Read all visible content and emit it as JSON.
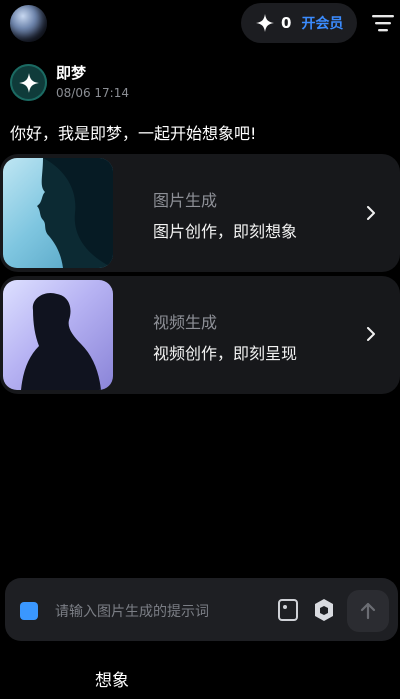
{
  "header": {
    "credits": "0",
    "join_vip": "开会员"
  },
  "message": {
    "bot_name": "即梦",
    "time": "08/06 17:14",
    "greeting": "你好，我是即梦，一起开始想象吧!"
  },
  "cards": [
    {
      "title": "图片生成",
      "subtitle": "图片创作，即刻想象"
    },
    {
      "title": "视频生成",
      "subtitle": "视频创作，即刻呈现"
    }
  ],
  "input": {
    "placeholder": "请输入图片生成的提示词"
  },
  "bottom_tab": {
    "label": "想象"
  },
  "colors": {
    "accent": "#3b8cff",
    "background": "#000000",
    "card": "#17181b"
  }
}
